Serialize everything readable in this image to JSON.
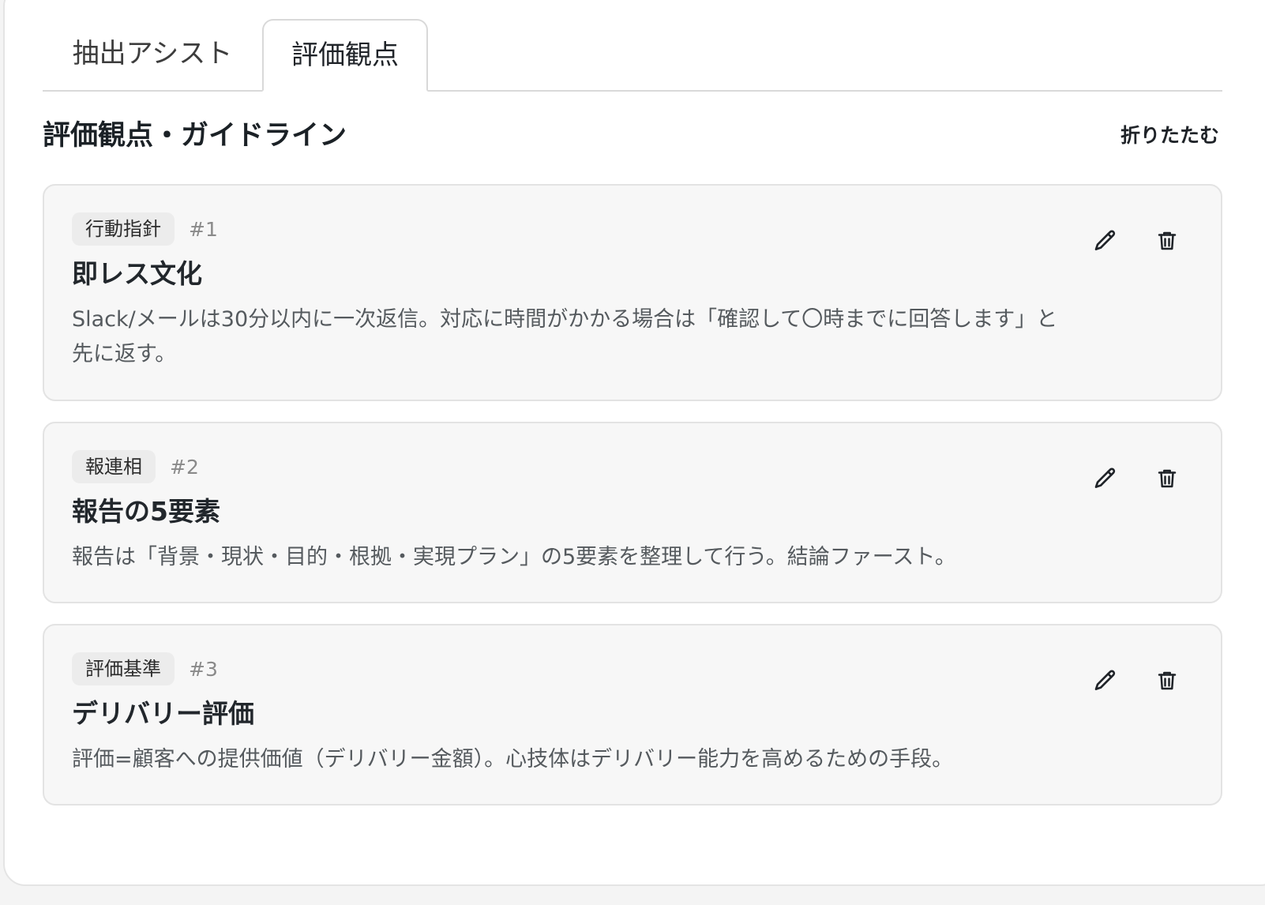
{
  "tabs": [
    {
      "label": "抽出アシスト",
      "active": false
    },
    {
      "label": "評価観点",
      "active": true
    }
  ],
  "section": {
    "title": "評価観点・ガイドライン",
    "collapse_label": "折りたたむ"
  },
  "cards": [
    {
      "tag": "行動指針",
      "number": "#1",
      "title": "即レス文化",
      "description": "Slack/メールは30分以内に一次返信。対応に時間がかかる場合は「確認して〇時までに回答します」と先に返す。"
    },
    {
      "tag": "報連相",
      "number": "#2",
      "title": "報告の5要素",
      "description": "報告は「背景・現状・目的・根拠・実現プラン」の5要素を整理して行う。結論ファースト。"
    },
    {
      "tag": "評価基準",
      "number": "#3",
      "title": "デリバリー評価",
      "description": "評価=顧客への提供価値（デリバリー金額）。心技体はデリバリー能力を高めるための手段。"
    }
  ],
  "icons": {
    "edit": "pencil-icon",
    "delete": "trash-icon"
  },
  "colors": {
    "panel_background": "#ffffff",
    "card_background": "#f7f7f7",
    "tag_background": "#ececec",
    "text_primary": "#1f2328",
    "text_secondary": "#555a5e",
    "text_muted": "#8a8a8a"
  }
}
